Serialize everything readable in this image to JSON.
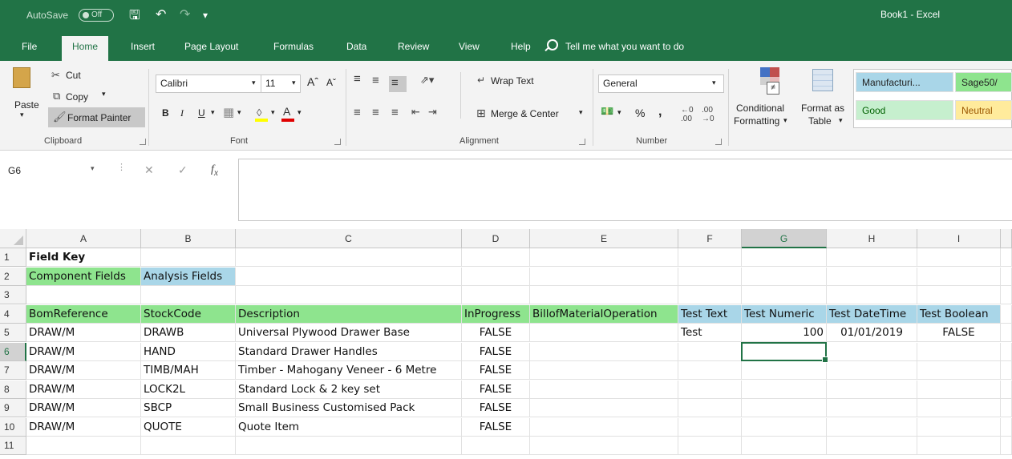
{
  "title_bar": {
    "autosave_label": "AutoSave",
    "autosave_state": "Off",
    "save_icon": "save-icon",
    "undo_icon": "undo-icon",
    "redo_icon": "redo-icon",
    "window_title": "Book1  -  Excel"
  },
  "tabs": [
    {
      "label": "File"
    },
    {
      "label": "Home"
    },
    {
      "label": "Insert"
    },
    {
      "label": "Page Layout"
    },
    {
      "label": "Formulas"
    },
    {
      "label": "Data"
    },
    {
      "label": "Review"
    },
    {
      "label": "View"
    },
    {
      "label": "Help"
    }
  ],
  "tell_me": "Tell me what you want to do",
  "ribbon": {
    "clipboard": {
      "paste": "Paste",
      "cut": "Cut",
      "copy": "Copy",
      "format_painter": "Format Painter",
      "label": "Clipboard"
    },
    "font": {
      "name": "Calibri",
      "size": "11",
      "label": "Font",
      "bold": "B",
      "italic": "I",
      "underline": "U"
    },
    "alignment": {
      "wrap_text": "Wrap Text",
      "merge_center": "Merge & Center",
      "label": "Alignment"
    },
    "number": {
      "format": "General",
      "percent": "%",
      "comma": ",",
      "label": "Number"
    },
    "styles": {
      "conditional": "Conditional",
      "conditional2": "Formatting",
      "format_as": "Format as",
      "format_as2": "Table",
      "cell_styles": [
        "Manufacturi...",
        "Sage50/",
        "Good",
        "Neutral"
      ]
    }
  },
  "formula_bar": {
    "name_box": "G6",
    "formula": ""
  },
  "grid": {
    "columns": [
      "A",
      "B",
      "C",
      "D",
      "E",
      "F",
      "G",
      "H",
      "I"
    ],
    "rows": [
      "1",
      "2",
      "3",
      "4",
      "5",
      "6",
      "7",
      "8",
      "9",
      "10",
      "11"
    ],
    "selected_column": "G",
    "selected_row": "6",
    "r1": {
      "A": "Field Key"
    },
    "r2": {
      "A": "Component Fields",
      "B": "Analysis Fields"
    },
    "r4": {
      "A": "BomReference",
      "B": "StockCode",
      "C": "Description",
      "D": "InProgress",
      "E": "BillofMaterialOperation",
      "F": "Test Text",
      "G": "Test Numeric",
      "H": "Test DateTime",
      "I": "Test Boolean"
    },
    "r5": {
      "A": "DRAW/M",
      "B": "DRAWB",
      "C": "Universal Plywood Drawer Base",
      "D": "FALSE",
      "F": "Test",
      "G": "100",
      "H": "01/01/2019",
      "I": "FALSE"
    },
    "r6": {
      "A": "DRAW/M",
      "B": "HAND",
      "C": "Standard Drawer Handles",
      "D": "FALSE"
    },
    "r7": {
      "A": "DRAW/M",
      "B": "TIMB/MAH",
      "C": "Timber - Mahogany Veneer - 6 Metre",
      "D": "FALSE"
    },
    "r8": {
      "A": "DRAW/M",
      "B": "LOCK2L",
      "C": "Standard Lock & 2 key set",
      "D": "FALSE"
    },
    "r9": {
      "A": "DRAW/M",
      "B": "SBCP",
      "C": "Small Business Customised Pack",
      "D": "FALSE"
    },
    "r10": {
      "A": "DRAW/M",
      "B": "QUOTE",
      "C": "Quote Item",
      "D": "FALSE"
    }
  },
  "colors": {
    "excel_green": "#217346",
    "component_green": "#8ee48e",
    "analysis_blue": "#a9d6e8"
  }
}
